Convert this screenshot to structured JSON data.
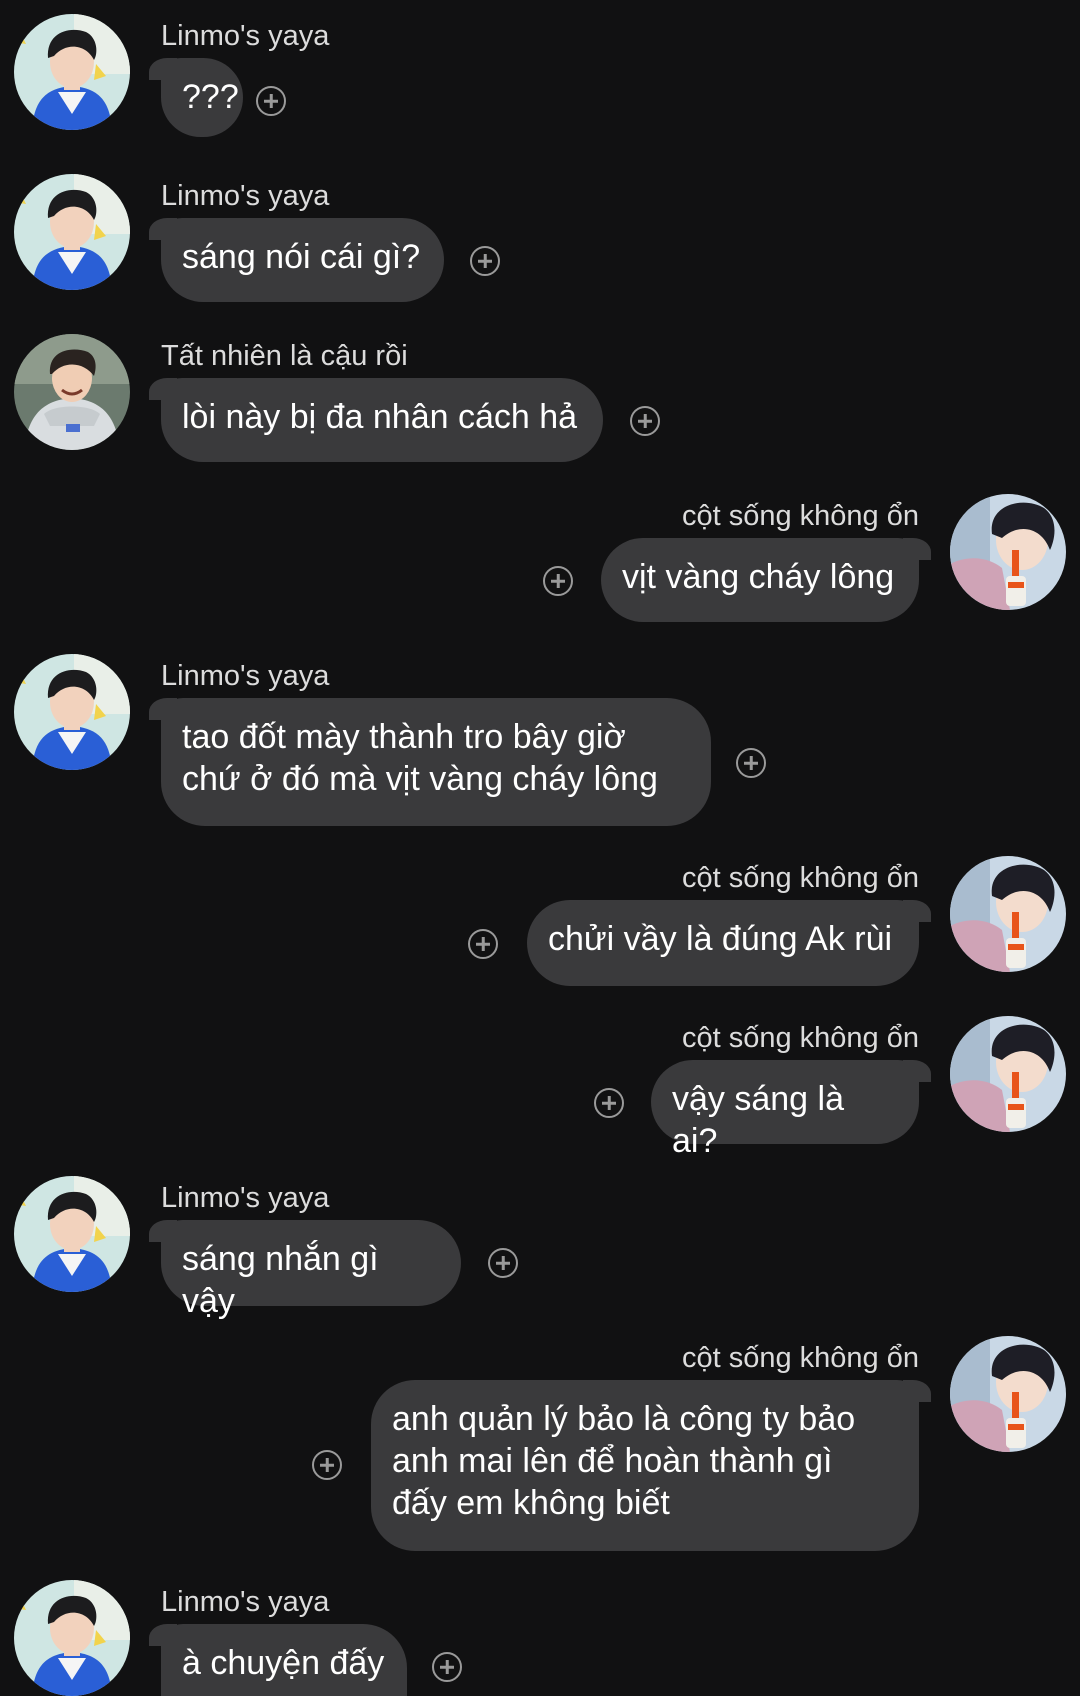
{
  "messages": [
    {
      "sender": "Linmo's yaya",
      "text": "???",
      "direction": "in",
      "avatar_icon": "avatar-blue-jacket"
    },
    {
      "sender": "Linmo's yaya",
      "text": "sáng nói cái gì?",
      "direction": "in",
      "avatar_icon": "avatar-blue-jacket"
    },
    {
      "sender": "Tất nhiên là cậu rồi",
      "text": "lòi này bị đa nhân cách hả",
      "direction": "in",
      "avatar_icon": "avatar-grey-hoodie"
    },
    {
      "sender": "cột sống không ổn",
      "text": "vịt vàng cháy lông",
      "direction": "out",
      "avatar_icon": "avatar-drinking"
    },
    {
      "sender": "Linmo's yaya",
      "text": "tao đốt mày thành tro bây giờ\nchứ ở đó mà vịt vàng cháy lông",
      "direction": "in",
      "avatar_icon": "avatar-blue-jacket"
    },
    {
      "sender": "cột sống không ổn",
      "text": "chửi vầy là đúng Ak rùi",
      "direction": "out",
      "avatar_icon": "avatar-drinking"
    },
    {
      "sender": "cột sống không ổn",
      "text": "vậy sáng là ai?",
      "direction": "out",
      "avatar_icon": "avatar-drinking"
    },
    {
      "sender": "Linmo's yaya",
      "text": "sáng nhắn gì vậy",
      "direction": "in",
      "avatar_icon": "avatar-blue-jacket"
    },
    {
      "sender": "cột sống không ổn",
      "text": "anh quản lý bảo là công ty bảo\nanh mai lên để hoàn thành gì\nđấy em không biết",
      "direction": "out",
      "avatar_icon": "avatar-drinking"
    },
    {
      "sender": "Linmo's yaya",
      "text": "à chuyện đấy",
      "direction": "in",
      "avatar_icon": "avatar-blue-jacket"
    }
  ],
  "colors": {
    "background": "#111112",
    "bubble": "#3a3a3c",
    "sender_text": "#dcdcdc",
    "react_icon": "#9a9a9a"
  }
}
